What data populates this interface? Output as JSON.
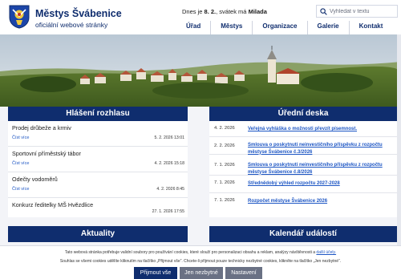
{
  "header": {
    "site_title": "Městys Švábenice",
    "site_subtitle": "oficiální webové stránky",
    "today_prefix": "Dnes je",
    "today_date": "8. 2.",
    "today_middle": ", svátek má",
    "today_name": "Milada",
    "logo_icon": "coat-of-arms-icon"
  },
  "search": {
    "placeholder": "Vyhledat v textu",
    "icon": "search-icon"
  },
  "nav": {
    "items": [
      "Úřad",
      "Městys",
      "Organizace",
      "Galerie",
      "Kontakt"
    ]
  },
  "news": {
    "title": "Hlášení rozhlasu",
    "items": [
      {
        "title": "Prodej drůbeže a krmiv",
        "more": "Číst více",
        "date": "5. 2. 2026 13:01"
      },
      {
        "title": "Sportovní příměstský tábor",
        "more": "Číst více",
        "date": "4. 2. 2026 15:18"
      },
      {
        "title": "Odečty vodoměrů",
        "more": "Číst více",
        "date": "4. 2. 2026 8:45"
      },
      {
        "title": "Konkurz ředitelky MŠ Hvězdlice",
        "more": "",
        "date": "27. 1. 2026 17:55"
      }
    ]
  },
  "desk": {
    "title": "Úřední deska",
    "items": [
      {
        "date": "4. 2. 2026",
        "title": "Veřejná vyhláška o možnosti převzít písemnost."
      },
      {
        "date": "2. 2. 2026",
        "title": "Smlouva o poskytnutí neinvestičního příspěvku z rozpočtu městyse Švábenice č.3/2026"
      },
      {
        "date": "7. 1. 2026",
        "title": "Smlouva o poskytnutí neinvestičního příspěvku z rozpočtu městyse Švábenice č.8/2026"
      },
      {
        "date": "7. 1. 2026",
        "title": "Střednědobý výhled rozpočtu 2027-2028"
      },
      {
        "date": "7. 1. 2026",
        "title": "Rozpočet městyse Švábenice 2026"
      }
    ]
  },
  "bottom_panels": {
    "left_title": "Aktuality",
    "right_title": "Kalendář událostí"
  },
  "cookie": {
    "line1_before": "Tato webová stránka potřebuje validní soubory pro používání cookies, které slouží pro personalizaci obsahu a reklam, analýzy návštěvnosti a",
    "line1_link": "další účely.",
    "line2": "Souhlas se všemi cookies udělíte kliknutím na tlačítko „Přijmout vše“. Chcete-li přijmout pouze technicky nezbytné cookies, klikněte na tlačítko „Jen nezbytné“.",
    "accept_label": "Přijmout vše",
    "necessary_label": "Jen nezbytné",
    "settings_label": "Nastavení"
  },
  "colors": {
    "brand_navy": "#0f2d6e",
    "link_blue": "#1d56c4",
    "page_bg": "#f3f4f8"
  }
}
